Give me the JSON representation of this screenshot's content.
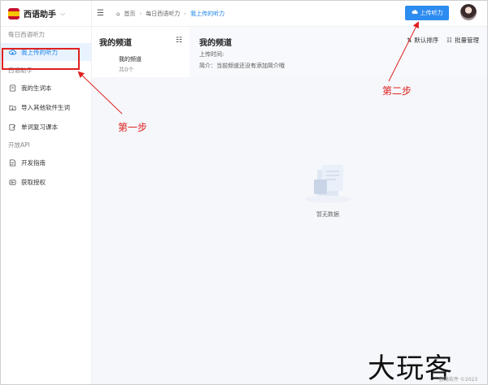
{
  "brand": {
    "name": "西语助手"
  },
  "sidebar": {
    "sections": [
      {
        "title": "每日西语听力",
        "items": [
          {
            "label": "我上传的听力",
            "icon": "cloud-upload-icon",
            "active": true
          }
        ]
      },
      {
        "title": "西语助手",
        "items": [
          {
            "label": "我的生词本",
            "icon": "book-icon"
          },
          {
            "label": "导入其他软件生词",
            "icon": "folder-import-icon"
          },
          {
            "label": "单词复习课本",
            "icon": "edit-icon"
          }
        ]
      },
      {
        "title": "开放API",
        "items": [
          {
            "label": "开发指南",
            "icon": "guide-icon"
          },
          {
            "label": "获取授权",
            "icon": "key-icon"
          }
        ]
      }
    ]
  },
  "topbar": {
    "breadcrumbs": [
      "首页",
      "每日西语听力",
      "我上传的听力"
    ],
    "upload_label": "上传听力"
  },
  "channels": {
    "title": "我的频道",
    "item_name": "我的频道",
    "item_count": "共0个"
  },
  "detail": {
    "title": "我的频道",
    "upload_time": "上传时间:",
    "intro": "简介：当前频道还没有添加简介哦",
    "sort_label": "默认排序",
    "bulk_label": "批量管理"
  },
  "empty": {
    "text": "暂无数据"
  },
  "annotations": {
    "step1": "第一步",
    "step2": "第二步"
  },
  "watermark": {
    "text": "大玩客",
    "small": "欧路软件 ©2023"
  },
  "colors": {
    "accent": "#2d8cf0",
    "annotation": "#e02020",
    "active_bg": "#e9f3ff"
  }
}
